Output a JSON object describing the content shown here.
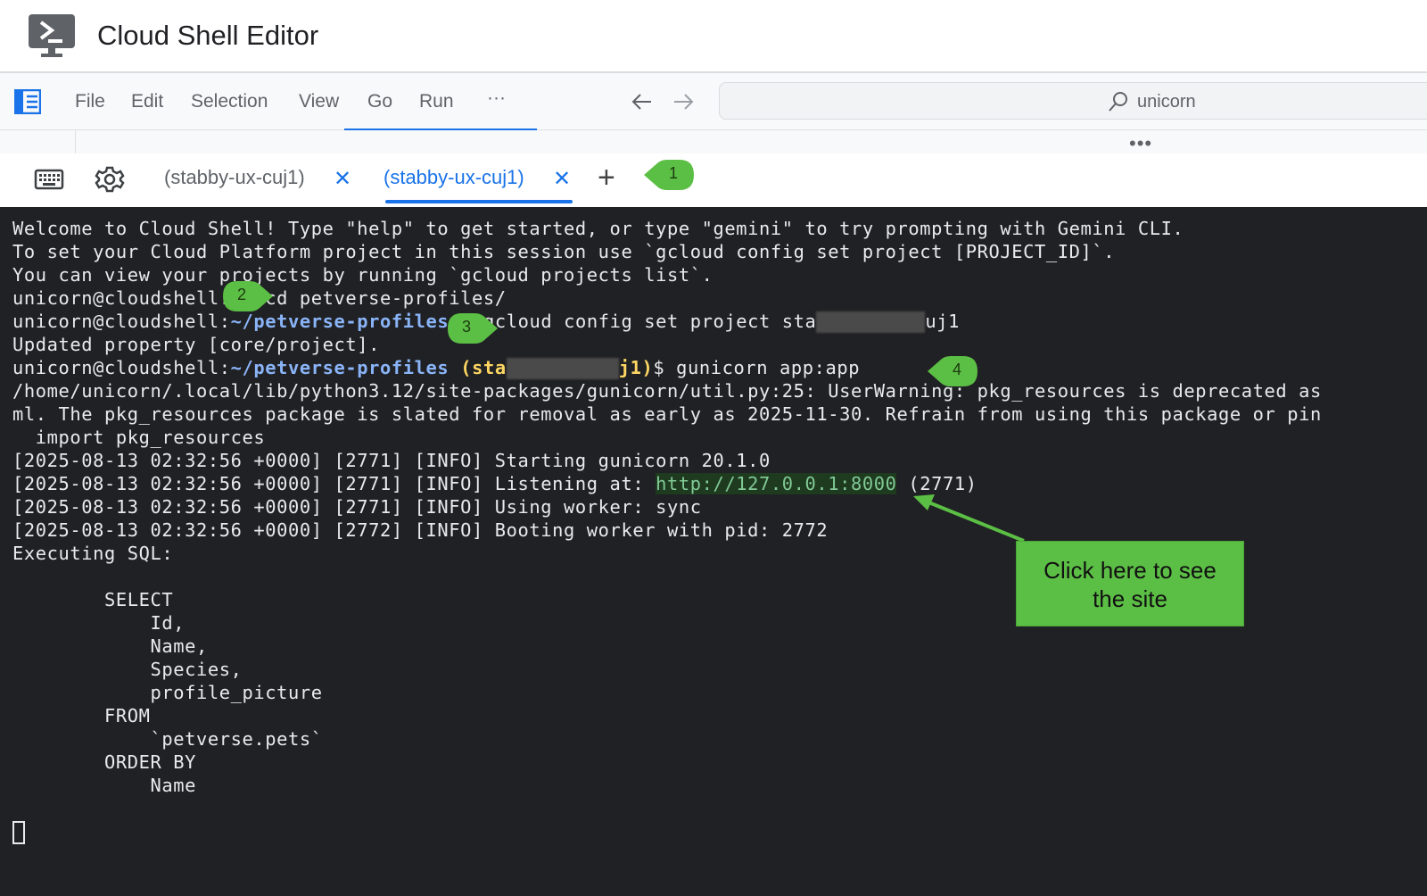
{
  "app": {
    "title": "Cloud Shell Editor"
  },
  "menu": {
    "items": [
      "File",
      "Edit",
      "Selection",
      "View",
      "Go",
      "Run",
      "···"
    ]
  },
  "search": {
    "text": "unicorn"
  },
  "strip": {
    "overflow": "•••"
  },
  "tabs": [
    {
      "label": "(stabby-ux-cuj1)",
      "active": false
    },
    {
      "label": "(stabby-ux-cuj1)",
      "active": true
    }
  ],
  "tab_close_glyph": "✕",
  "add_tab_glyph": "+",
  "markers": [
    "1",
    "2",
    "3",
    "4"
  ],
  "terminal": {
    "welcome": "Welcome to Cloud Shell! Type \"help\" to get started, or type \"gemini\" to try prompting with Gemini CLI.",
    "set_project": "To set your Cloud Platform project in this session use `gcloud config set project [PROJECT_ID]`.",
    "view_projects": "You can view your projects by running `gcloud projects list`.",
    "prompt1_user": "unicorn@cloudshell",
    "prompt1_rest": ":~$ cd petverse-profiles/",
    "prompt2_user": "unicorn@cloudshell:",
    "prompt2_path": "~/petverse-profiles",
    "prompt2_cmd": "$ gcloud config set project sta",
    "prompt2_tail": "uj1",
    "updated": "Updated property [core/project].",
    "prompt3_user": "unicorn@cloudshell:",
    "prompt3_path": "~/petverse-profiles",
    "prompt3_proj_a": "(sta",
    "prompt3_proj_b": "j1)",
    "prompt3_cmd": "$ gunicorn app:app",
    "warn1": "/home/unicorn/.local/lib/python3.12/site-packages/gunicorn/util.py:25: UserWarning: pkg_resources is deprecated as",
    "warn2": "ml. The pkg_resources package is slated for removal as early as 2025-11-30. Refrain from using this package or pin",
    "warn3": "  import pkg_resources",
    "log1": "[2025-08-13 02:32:56 +0000] [2771] [INFO] Starting gunicorn 20.1.0",
    "log2_prefix": "[2025-08-13 02:32:56 +0000] [2771] [INFO] Listening at: ",
    "log2_link": "http://127.0.0.1:8000",
    "log2_suffix": " (2771)",
    "log3": "[2025-08-13 02:32:56 +0000] [2771] [INFO] Using worker: sync",
    "log4": "[2025-08-13 02:32:56 +0000] [2772] [INFO] Booting worker with pid: 2772",
    "exec": "Executing SQL:",
    "sql": [
      "        SELECT",
      "            Id,",
      "            Name,",
      "            Species,",
      "            profile_picture",
      "        FROM",
      "            `petverse.pets`",
      "        ORDER BY",
      "            Name"
    ]
  },
  "tip": {
    "line1": "Click here to see",
    "line2": "the site"
  },
  "colors": {
    "accent": "#1a73e8",
    "terminal_bg": "#202124",
    "callout": "#5cbf45"
  }
}
